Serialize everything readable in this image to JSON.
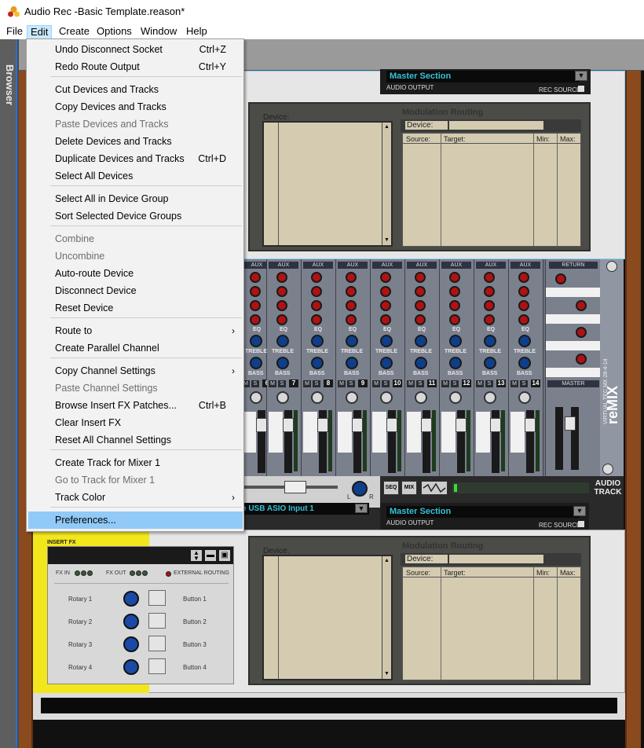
{
  "window": {
    "title": "Audio Rec -Basic Template.reason*"
  },
  "menubar": [
    "File",
    "Edit",
    "Create",
    "Options",
    "Window",
    "Help"
  ],
  "browser": {
    "label": "Browser"
  },
  "edit_menu": {
    "items": [
      {
        "label": "Undo Disconnect Socket",
        "shortcut": "Ctrl+Z",
        "enabled": true
      },
      {
        "label": "Redo Route Output",
        "shortcut": "Ctrl+Y",
        "enabled": true
      },
      {
        "label": "Cut Devices and Tracks",
        "shortcut": "",
        "enabled": true
      },
      {
        "label": "Copy Devices and Tracks",
        "shortcut": "",
        "enabled": true
      },
      {
        "label": "Paste Devices and Tracks",
        "shortcut": "",
        "enabled": false
      },
      {
        "label": "Delete Devices and Tracks",
        "shortcut": "",
        "enabled": true
      },
      {
        "label": "Duplicate Devices and Tracks",
        "shortcut": "Ctrl+D",
        "enabled": true
      },
      {
        "label": "Select All Devices",
        "shortcut": "",
        "enabled": true
      },
      {
        "label": "Select All in Device Group",
        "shortcut": "",
        "enabled": true
      },
      {
        "label": "Sort Selected Device Groups",
        "shortcut": "",
        "enabled": true
      },
      {
        "label": "Combine",
        "shortcut": "",
        "enabled": false
      },
      {
        "label": "Uncombine",
        "shortcut": "",
        "enabled": false
      },
      {
        "label": "Auto-route Device",
        "shortcut": "",
        "enabled": true
      },
      {
        "label": "Disconnect Device",
        "shortcut": "",
        "enabled": true
      },
      {
        "label": "Reset Device",
        "shortcut": "",
        "enabled": true
      },
      {
        "label": "Route to",
        "shortcut": "",
        "enabled": true,
        "submenu": true
      },
      {
        "label": "Create Parallel Channel",
        "shortcut": "",
        "enabled": true
      },
      {
        "label": "Copy Channel Settings",
        "shortcut": "",
        "enabled": true,
        "submenu": true
      },
      {
        "label": "Paste Channel Settings",
        "shortcut": "",
        "enabled": false
      },
      {
        "label": "Browse Insert FX Patches...",
        "shortcut": "Ctrl+B",
        "enabled": true
      },
      {
        "label": "Clear Insert FX",
        "shortcut": "",
        "enabled": true
      },
      {
        "label": "Reset All Channel Settings",
        "shortcut": "",
        "enabled": true
      },
      {
        "label": "Create Track for Mixer 1",
        "shortcut": "",
        "enabled": true
      },
      {
        "label": "Go to Track for Mixer 1",
        "shortcut": "",
        "enabled": false
      },
      {
        "label": "Track Color",
        "shortcut": "",
        "enabled": true,
        "submenu": true
      },
      {
        "label": "Preferences...",
        "shortcut": "",
        "enabled": true,
        "highlighted": true
      }
    ]
  },
  "rack": {
    "master_section_top": {
      "name": "Master Section",
      "audio_output": "AUDIO OUTPUT",
      "rec_source": "REC SOURCE"
    },
    "mod_routing_top": {
      "device_label": "Device:",
      "title": "Modulation Routing",
      "device2_label": "Device:",
      "cols": [
        "Source:",
        "Target:",
        "Min:",
        "Max:"
      ]
    },
    "mixer": {
      "aux": "AUX",
      "eq": "EQ",
      "treble": "TREBLE",
      "bass": "BASS",
      "channel_numbers": [
        "6",
        "7",
        "8",
        "9",
        "10",
        "11",
        "12",
        "13",
        "14"
      ],
      "mute": "M",
      "solo": "S",
      "return": "RETURN",
      "master": "MASTER",
      "model": "VIRTUAL TEC MX 28-4-14",
      "brand": "reMIX"
    },
    "audio_track": {
      "input": "e USB ASIO Input 1",
      "seq": "SEQ",
      "mix": "MIX",
      "label": "AUDIO\nTRACK",
      "lr_left": "L",
      "lr_right": "R",
      "master_section": "Master Section",
      "audio_output": "AUDIO OUTPUT",
      "rec_source": "REC SOURCE"
    },
    "insert_fx": {
      "title": "INSERT FX",
      "fx_in": "FX IN",
      "fx_out": "FX OUT",
      "external_routing": "EXTERNAL ROUTING",
      "rotaries": [
        "Rotary 1",
        "Rotary 2",
        "Rotary 3",
        "Rotary 4"
      ],
      "buttons": [
        "Button 1",
        "Button 2",
        "Button 3",
        "Button 4"
      ]
    },
    "mod_routing_bottom": {
      "device_label": "Device:",
      "title": "Modulation Routing",
      "device2_label": "Device:",
      "cols": [
        "Source:",
        "Target:",
        "Min:",
        "Max:"
      ]
    }
  }
}
